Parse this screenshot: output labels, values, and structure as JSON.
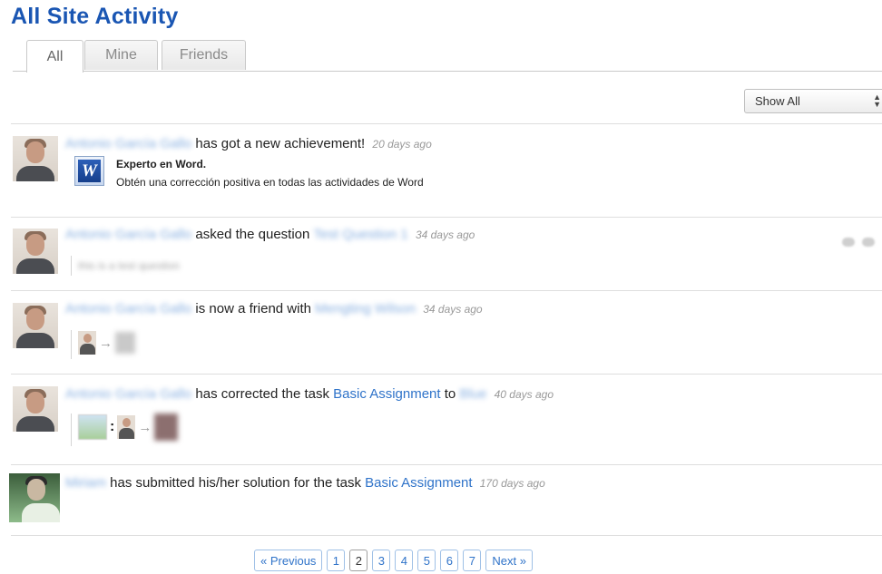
{
  "page": {
    "title": "All Site Activity"
  },
  "tabs": [
    {
      "label": "All",
      "active": true
    },
    {
      "label": "Mine",
      "active": false
    },
    {
      "label": "Friends",
      "active": false
    }
  ],
  "filter": {
    "selected": "Show All"
  },
  "activity": [
    {
      "actor": "Antonio García Gallo",
      "action": "has got a new achievement!",
      "time": "20 days ago",
      "achievement": {
        "title": "Experto en Word.",
        "description": "Obtén una corrección positiva en todas las actividades de Word",
        "icon_letter": "W"
      }
    },
    {
      "actor": "Antonio García Gallo",
      "action": "asked the question",
      "target": "Test Question 1",
      "time": "34 days ago",
      "detail": "this is a test question"
    },
    {
      "actor": "Antonio García Gallo",
      "action": "is now a friend with",
      "target": "Mengting Wilson",
      "time": "34 days ago"
    },
    {
      "actor": "Antonio García Gallo",
      "action": "has corrected the task",
      "task": "Basic Assignment",
      "to_word": "to",
      "target": "Blue",
      "time": "40 days ago"
    },
    {
      "actor": "Miriam",
      "action": "has submitted his/her solution for the task",
      "task": "Basic Assignment",
      "time": "170 days ago"
    }
  ],
  "pagination": {
    "previous": "« Previous",
    "pages": [
      "1",
      "2",
      "3",
      "4",
      "5",
      "6",
      "7"
    ],
    "current": "2",
    "next": "Next »"
  }
}
